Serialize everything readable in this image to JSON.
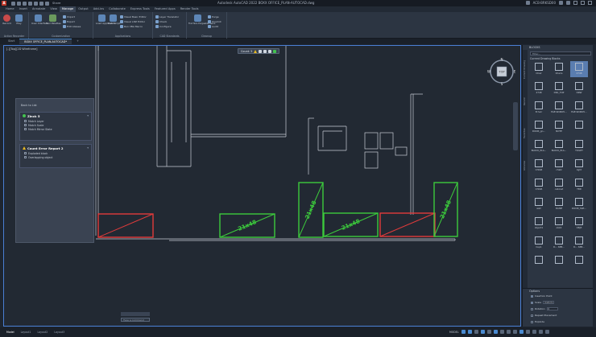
{
  "title_bar": {
    "app_logo": "A",
    "window_title": "Autodesk AutoCAD 2022   BOXX OFFICE_PLAN-AUTOCAD.dwg",
    "account": "ACB-BRKSD00",
    "share": "Share"
  },
  "ribbon_tabs": [
    "Home",
    "Insert",
    "Annotate",
    "View",
    "Manage",
    "Output",
    "Add-ins",
    "Collaborate",
    "Express Tools",
    "Featured Apps",
    "Render Tools"
  ],
  "ribbon_active_tab": "Manage",
  "ribbon_panels": [
    {
      "title": "Action Recorder",
      "big": [
        {
          "label": "Record"
        },
        {
          "label": "Play"
        }
      ]
    },
    {
      "title": "Customization",
      "big": [
        {
          "label": "User Interface"
        },
        {
          "label": "Tool Palettes"
        }
      ],
      "small": [
        "Import",
        "Export",
        "Edit Aliases"
      ]
    },
    {
      "title": "Applications",
      "big": [
        {
          "label": "Load Application"
        },
        {
          "label": "Run Script"
        }
      ],
      "small": [
        "Visual Basic Editor",
        "Visual LISP Editor",
        "Run VBA Macro"
      ]
    },
    {
      "title": "CAD Standards",
      "small": [
        "Layer Translator",
        "Check",
        "Configure"
      ]
    },
    {
      "title": "Cleanup",
      "big": [
        {
          "label": "Find Non-Purgeable Items"
        }
      ],
      "small": [
        "Purge",
        "Overkill",
        "Audit"
      ]
    }
  ],
  "file_tabs": [
    "Start",
    "BOXX OFFICE_PLAN-AUTOCAD*"
  ],
  "file_tab_active": "BOXX OFFICE_PLAN-AUTOCAD*",
  "viewport_label": "[-][Top][2D Wireframe]",
  "view_toolbar": {
    "label": "Count: 5"
  },
  "viewcube": {
    "north": "N",
    "south": "S",
    "east": "E",
    "west": "W",
    "face": "TOP",
    "wcs": "WCS"
  },
  "count_panel": {
    "back_label": "Back to List",
    "sections": [
      {
        "title": "Zinck 5",
        "status": "ok",
        "items": [
          "Match Layer",
          "Match Scale",
          "Match Mirror State"
        ]
      },
      {
        "title": "Count Error Report 2",
        "status": "warning",
        "items": [
          "Exploded block",
          "Overlapping object"
        ]
      }
    ]
  },
  "drawing": {
    "block_label": "21x48",
    "ok_color": "#3ccb3c",
    "error_color": "#e23b3b"
  },
  "command_line": {
    "placeholder": "Type a command"
  },
  "block_palette": {
    "title": "BLOCKS",
    "side_tabs": [
      "Current Drawing",
      "Recent",
      "Favorites",
      "Libraries"
    ],
    "filter_placeholder": "Filter...",
    "current_label": "Current Drawing Blocks",
    "blocks": [
      "Chair",
      "Chairs",
      "2748",
      "2748",
      "DSK_TOP",
      "DRW",
      "B hair",
      "EAE-WORK5...",
      "EAE-WORK5...",
      "DOOR_gn...",
      "NOTE",
      "",
      "BLOCK_PLA...",
      "BLOCK_PLA...",
      "TOILET",
      "CHAIR",
      "chalk",
      "light",
      "CHAIR",
      "cabinet",
      "TBD",
      "wall",
      "DAISE",
      "DOOR_SWI...",
      "object1",
      "obk2",
      "OBJ3",
      "Cup1",
      "D... SEB...",
      "D... SEB...",
      "",
      "",
      ""
    ]
  },
  "options": {
    "title": "Options",
    "rows": [
      {
        "label": "Insertion Point",
        "checked": true
      },
      {
        "label": "Scale",
        "value": "Uniform",
        "checked": true
      },
      {
        "label": "Rotation",
        "value": "0",
        "checked": false
      },
      {
        "label": "Repeat Placement",
        "checked": false
      },
      {
        "label": "Explode",
        "checked": false
      }
    ]
  },
  "layout_tabs": [
    "Model",
    "Layout1",
    "Layout2",
    "Layout3"
  ],
  "layout_active": "Model",
  "status_bar": {
    "model": "MODEL"
  }
}
